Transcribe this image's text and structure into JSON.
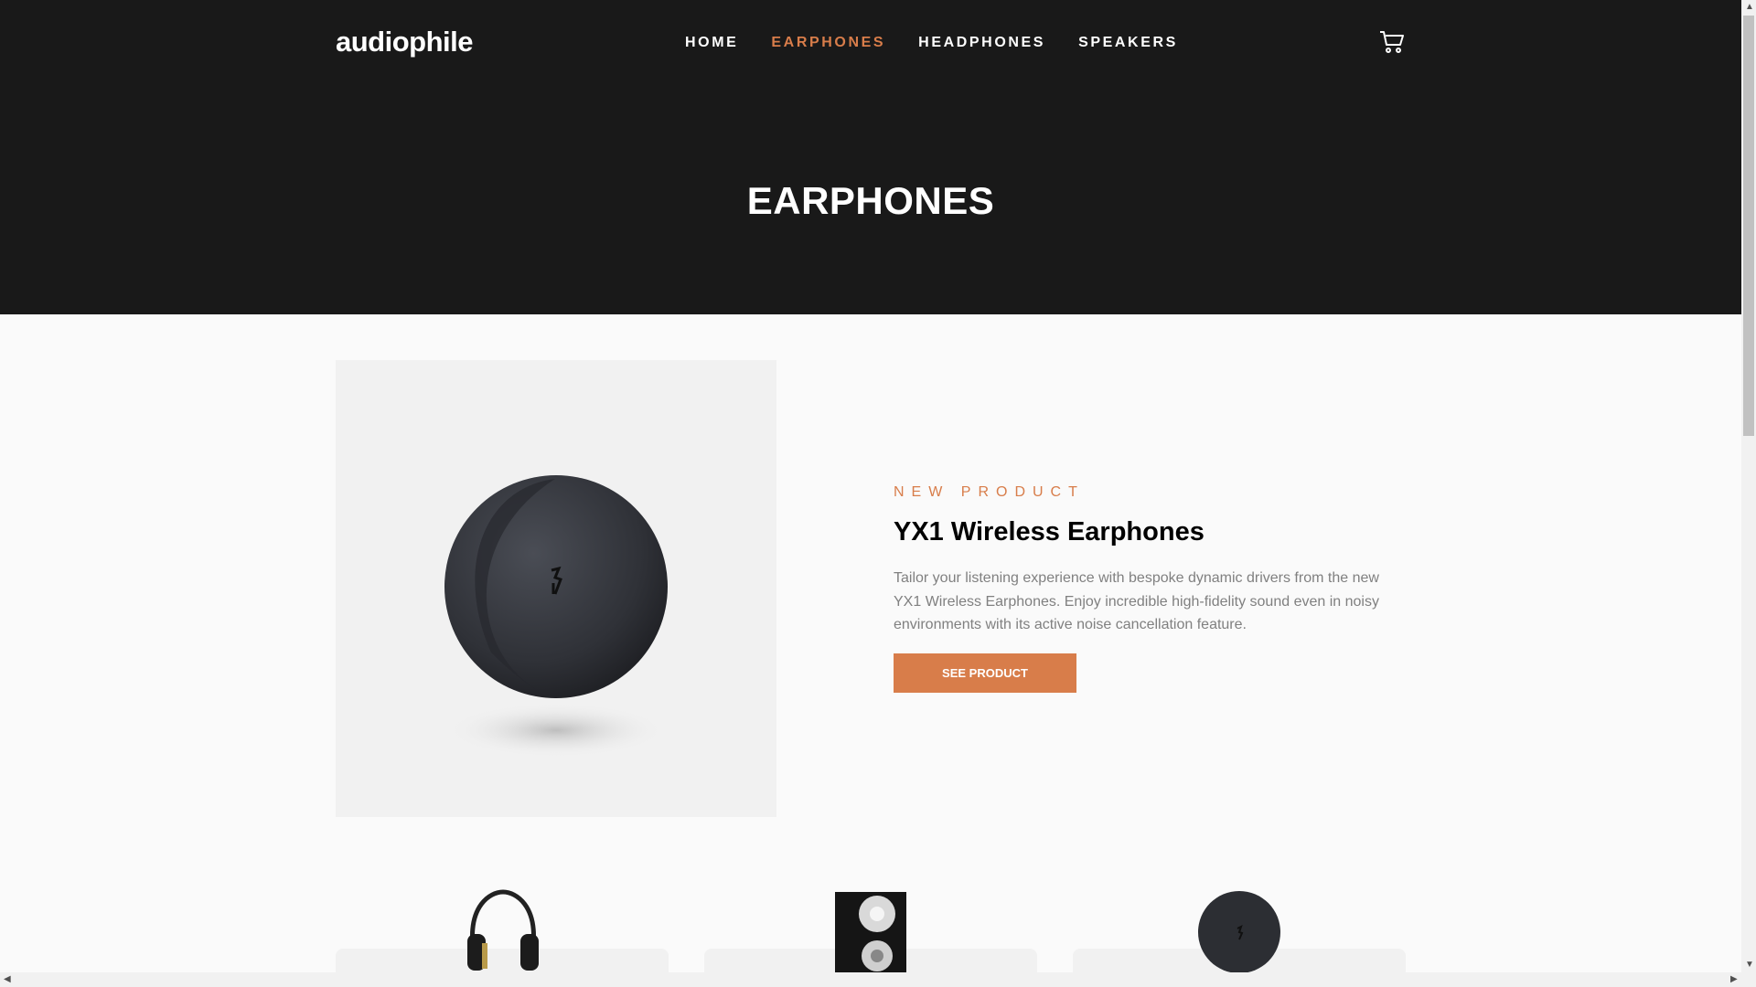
{
  "brand": "audiophile",
  "nav": {
    "items": [
      {
        "label": "HOME"
      },
      {
        "label": "EARPHONES"
      },
      {
        "label": "HEADPHONES"
      },
      {
        "label": "SPEAKERS"
      }
    ],
    "active": "EARPHONES",
    "cart_icon": "cart-icon"
  },
  "hero": {
    "title": "EARPHONES"
  },
  "product": {
    "overline": "NEW PRODUCT",
    "name": "YX1 Wireless Earphones",
    "description": "Tailor your listening experience with bespoke dynamic drivers from the new YX1 Wireless Earphones. Enjoy incredible high-fidelity sound even in noisy environments with its active noise cancellation feature.",
    "cta": "SEE PRODUCT",
    "image_icon": "earphones-case-image"
  },
  "categories": [
    {
      "icon": "headphones-image"
    },
    {
      "icon": "speaker-image"
    },
    {
      "icon": "earphones-image"
    }
  ],
  "colors": {
    "accent": "#d87d4a",
    "header_bg": "#191919",
    "page_bg": "#fafafa",
    "card_bg": "#f1f1f1",
    "body_text": "#808080"
  }
}
